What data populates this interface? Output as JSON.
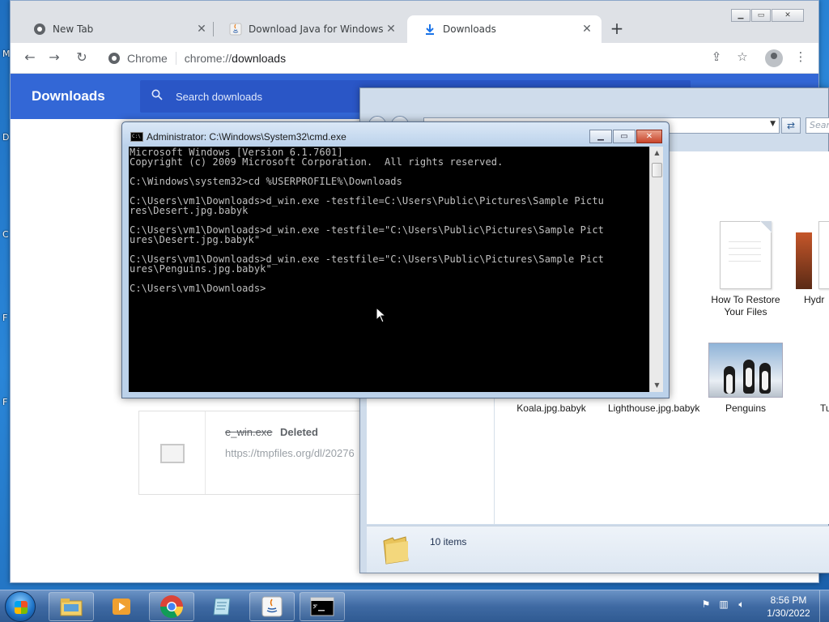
{
  "desktop": {
    "glyphs": [
      "M",
      "D",
      "C",
      "F",
      "F"
    ]
  },
  "chrome": {
    "tabs": [
      {
        "label": "New Tab",
        "icon": "chrome-icon",
        "active": false
      },
      {
        "label": "Download Java for Windows",
        "icon": "java-icon",
        "active": false
      },
      {
        "label": "Downloads",
        "icon": "download-icon",
        "active": true
      }
    ],
    "new_tab": "+",
    "omnibox": {
      "site": "Chrome",
      "url_prefix": "chrome://",
      "url_path": "downloads"
    },
    "downloads": {
      "title": "Downloads",
      "search_placeholder": "Search downloads",
      "item": {
        "filename": "e_win.exe",
        "status": "Deleted",
        "url": "https://tmpfiles.org/dl/20276"
      }
    }
  },
  "explorer": {
    "search_placeholder": "Sear",
    "files": [
      {
        "label": "How To Restore Your Files",
        "type": "document"
      },
      {
        "label": "Hydr",
        "type": "document"
      },
      {
        "label": "Koala.jpg.babyk",
        "type": "image"
      },
      {
        "label": "Lighthouse.jpg.babyk",
        "type": "image"
      },
      {
        "label": "Penguins",
        "type": "photo"
      },
      {
        "label": "Tulip",
        "type": "image"
      }
    ],
    "status": "10 items"
  },
  "cmd": {
    "title": "Administrator: C:\\Windows\\System32\\cmd.exe",
    "icon_text": "C:\\",
    "lines": [
      "Microsoft Windows [Version 6.1.7601]",
      "Copyright (c) 2009 Microsoft Corporation.  All rights reserved.",
      "",
      "C:\\Windows\\system32>cd %USERPROFILE%\\Downloads",
      "",
      "C:\\Users\\vm1\\Downloads>d_win.exe -testfile=C:\\Users\\Public\\Pictures\\Sample Pictu",
      "res\\Desert.jpg.babyk",
      "",
      "C:\\Users\\vm1\\Downloads>d_win.exe -testfile=\"C:\\Users\\Public\\Pictures\\Sample Pict",
      "ures\\Desert.jpg.babyk\"",
      "",
      "C:\\Users\\vm1\\Downloads>d_win.exe -testfile=\"C:\\Users\\Public\\Pictures\\Sample Pict",
      "ures\\Penguins.jpg.babyk\"",
      "",
      "C:\\Users\\vm1\\Downloads>"
    ]
  },
  "taskbar": {
    "apps": [
      "explorer-icon",
      "media-player-icon",
      "chrome-icon",
      "notepad-icon",
      "java-icon",
      "cmd-icon"
    ],
    "time": "8:56 PM",
    "date": "1/30/2022"
  },
  "colors": {
    "downloads_header": "#3367d6",
    "cmd_background": "#000000",
    "cmd_text": "#c0c0c0",
    "taskbar": "#3f6aa3"
  }
}
